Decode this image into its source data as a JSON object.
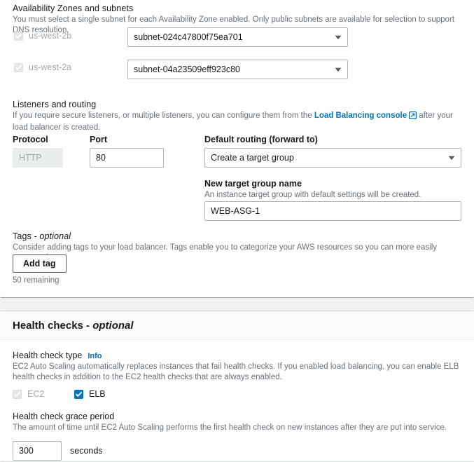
{
  "availability": {
    "title": "Availability Zones and subnets",
    "description": "You must select a single subnet for each Availability Zone enabled. Only public subnets are available for selection to support DNS resolution.",
    "zones": [
      {
        "name": "us-west-2b",
        "checked": true,
        "disabled": true,
        "subnet": "subnet-024c47800f75ea701"
      },
      {
        "name": "us-west-2a",
        "checked": true,
        "disabled": true,
        "subnet": "subnet-04a23509eff923c80"
      }
    ]
  },
  "listeners": {
    "title": "Listeners and routing",
    "description_prefix": "If you require secure listeners, or multiple listeners, you can configure them from the ",
    "link_text": "Load Balancing console",
    "description_suffix": " after your load balancer is created.",
    "protocol_label": "Protocol",
    "protocol_value": "HTTP",
    "port_label": "Port",
    "port_value": "80",
    "routing_label": "Default routing (forward to)",
    "routing_value": "Create a target group",
    "target_group_label": "New target group name",
    "target_group_description": "An instance target group with default settings will be created.",
    "target_group_value": "WEB-ASG-1"
  },
  "tags": {
    "title": "Tags - ",
    "title_optional": "optional",
    "description": "Consider adding tags to your load balancer. Tags enable you to categorize your AWS resources so you can more easily manage them.",
    "add_button": "Add tag",
    "remaining": "50 remaining"
  },
  "health": {
    "header_title": "Health checks - ",
    "header_optional": "optional",
    "type_label": "Health check type",
    "info_link": "Info",
    "type_description": "EC2 Auto Scaling automatically replaces instances that fail health checks. If you enabled load balancing, you can enable ELB health checks in addition to the EC2 health checks that are always enabled.",
    "options": [
      {
        "label": "EC2",
        "checked": true,
        "disabled": true
      },
      {
        "label": "ELB",
        "checked": true,
        "disabled": false
      }
    ],
    "grace_label": "Health check grace period",
    "grace_description": "The amount of time until EC2 Auto Scaling performs the first health check on new instances after they are put into service.",
    "grace_value": "300",
    "grace_unit": "seconds"
  },
  "colors": {
    "accent": "#0073bb",
    "text": "#16191f",
    "muted": "#687078",
    "border": "#aab7b8",
    "page_bg": "#eff0f1"
  }
}
